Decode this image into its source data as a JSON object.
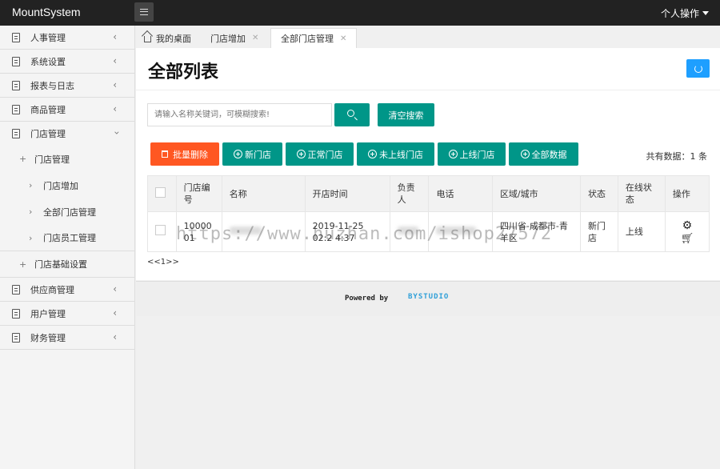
{
  "app": {
    "title": "MountSystem"
  },
  "topbar": {
    "user_menu": "个人操作"
  },
  "sidebar": {
    "items": [
      {
        "label": "人事管理"
      },
      {
        "label": "系统设置"
      },
      {
        "label": "报表与日志"
      },
      {
        "label": "商品管理"
      },
      {
        "label": "门店管理"
      },
      {
        "label": "供应商管理"
      },
      {
        "label": "用户管理"
      },
      {
        "label": "财务管理"
      }
    ],
    "store_sub": {
      "group_label": "门店管理",
      "children": [
        {
          "label": "门店增加"
        },
        {
          "label": "全部门店管理"
        },
        {
          "label": "门店员工管理"
        }
      ],
      "basic_settings": "门店基础设置"
    }
  },
  "tabs": [
    {
      "label": "我的桌面"
    },
    {
      "label": "门店增加"
    },
    {
      "label": "全部门店管理"
    }
  ],
  "page": {
    "title": "全部列表"
  },
  "search": {
    "placeholder": "请输入名称关键词，可模糊搜索!",
    "clear_label": "清空搜索"
  },
  "actions": {
    "batch_delete": "批量删除",
    "new_store": "新门店",
    "normal_store": "正常门店",
    "not_online": "未上线门店",
    "online": "上线门店",
    "all_data": "全部数据"
  },
  "total": "共有数据：1 条",
  "table": {
    "headers": [
      "门店编号",
      "名称",
      "开店时间",
      "负责人",
      "电话",
      "区域/城市",
      "状态",
      "在线状态",
      "操作"
    ],
    "rows": [
      {
        "id": "10000 01",
        "opened": "2019-11-25 02:2 4:37",
        "region": "四川省-成都市-青 羊区",
        "status": "新门店",
        "online_status": "上线"
      }
    ]
  },
  "pager": "<<1>>",
  "footer": {
    "powered_by": "Powered by",
    "brand": "BYSTUDIO"
  },
  "watermark": "https://www.huzhan.com/ishop27572",
  "colors": {
    "primary": "#009688",
    "danger": "#ff5722",
    "refresh": "#1e9fff",
    "topbar": "#222222"
  }
}
